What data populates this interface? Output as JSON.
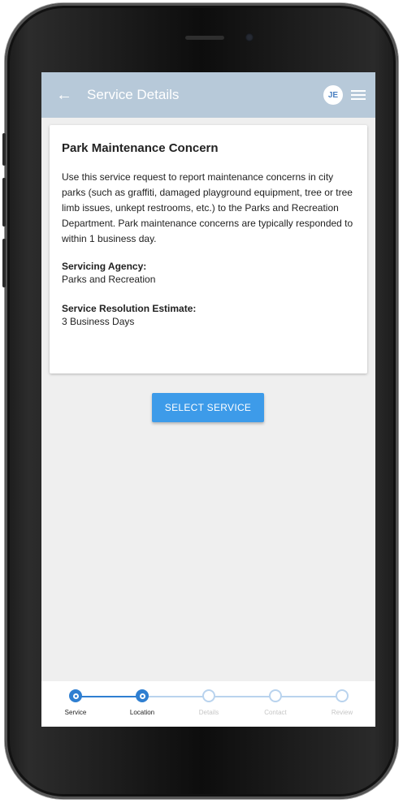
{
  "appbar": {
    "title": "Service Details",
    "avatar_initials": "JE"
  },
  "card": {
    "title": "Park Maintenance Concern",
    "description": "Use this service request to report maintenance concerns in city parks (such as graffiti, damaged playground equipment, tree or tree limb issues, unkept restrooms, etc.) to the Parks and Recreation Department. Park maintenance concerns are typically responded to within 1 business day.",
    "agency_label": "Servicing Agency:",
    "agency_value": "Parks and Recreation",
    "estimate_label": "Service Resolution Estimate:",
    "estimate_value": "3 Business Days"
  },
  "select_button_label": "SELECT SERVICE",
  "stepper": {
    "steps": [
      {
        "label": "Service",
        "state": "active"
      },
      {
        "label": "Location",
        "state": "active"
      },
      {
        "label": "Details",
        "state": "inactive"
      },
      {
        "label": "Contact",
        "state": "inactive"
      },
      {
        "label": "Review",
        "state": "inactive"
      }
    ]
  },
  "colors": {
    "appbar": "#b7c9d9",
    "primary": "#3d9be9",
    "active_step": "#2f7fd1",
    "inactive_step": "#b9d3ee"
  }
}
